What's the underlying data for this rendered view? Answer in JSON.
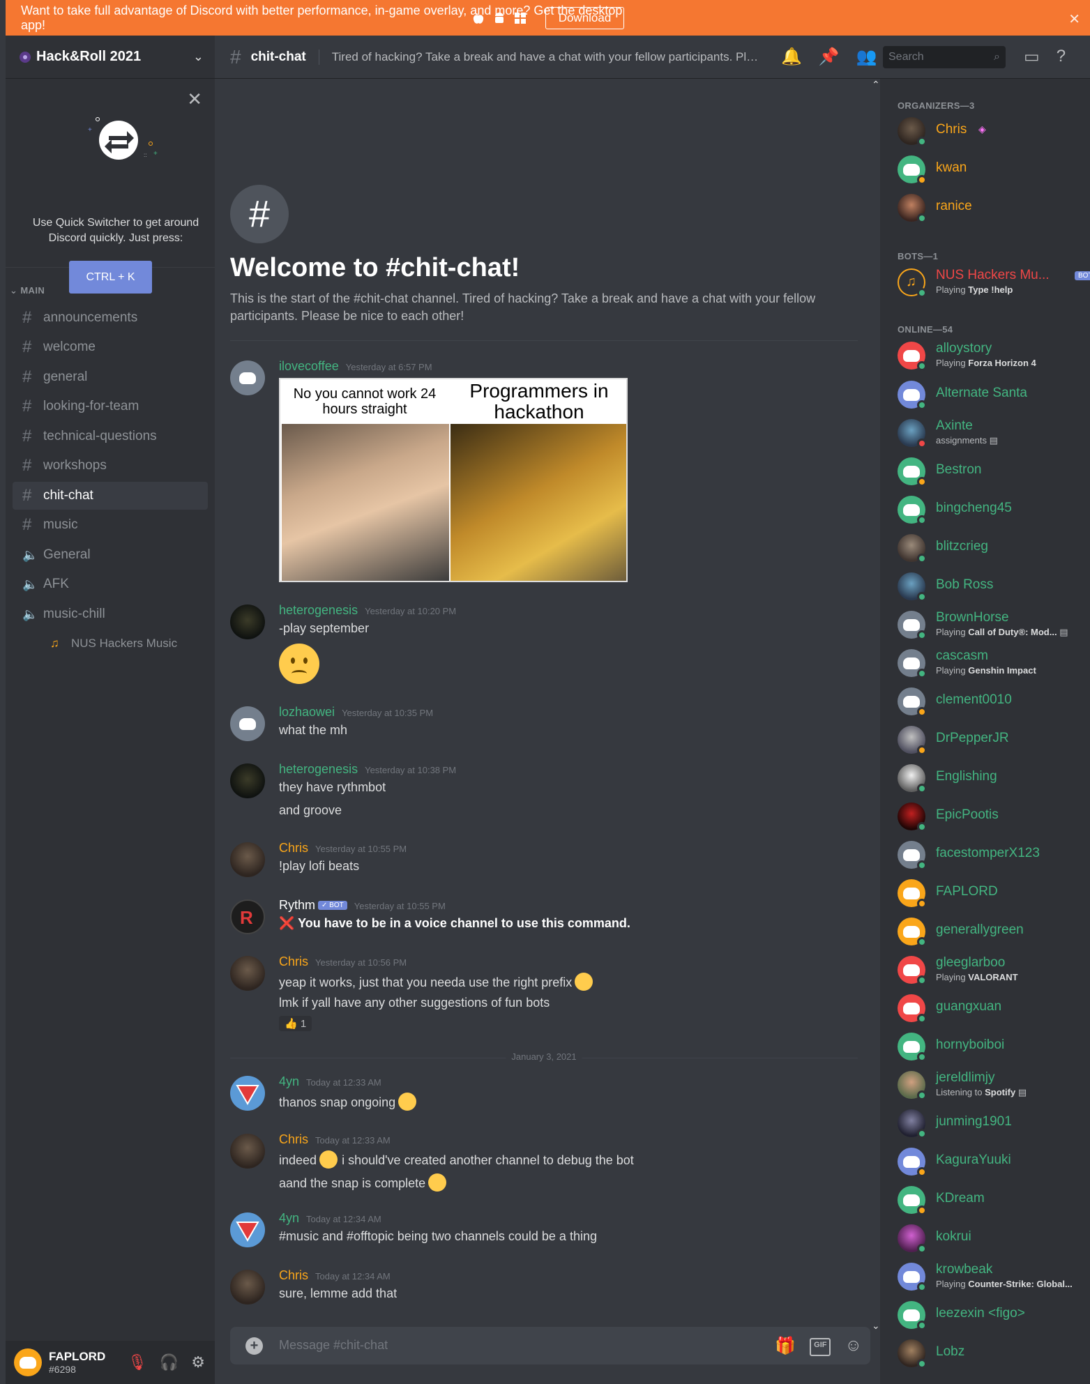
{
  "banner": {
    "message": "Want to take full advantage of Discord with better performance, in-game overlay, and more? Get the desktop app!",
    "download_label": "Download",
    "close_label": "✕"
  },
  "server": {
    "name": "Hack&Roll 2021"
  },
  "quick_switcher": {
    "text": "Use Quick Switcher to get around Discord quickly. Just press:",
    "shortcut": "CTRL + K"
  },
  "sidebar": {
    "category": "MAIN",
    "channels": [
      {
        "name": "announcements",
        "type": "text"
      },
      {
        "name": "welcome",
        "type": "text"
      },
      {
        "name": "general",
        "type": "text"
      },
      {
        "name": "looking-for-team",
        "type": "text"
      },
      {
        "name": "technical-questions",
        "type": "text"
      },
      {
        "name": "workshops",
        "type": "text"
      },
      {
        "name": "chit-chat",
        "type": "text",
        "active": true
      },
      {
        "name": "music",
        "type": "text"
      },
      {
        "name": "General",
        "type": "voice"
      },
      {
        "name": "AFK",
        "type": "voice"
      },
      {
        "name": "music-chill",
        "type": "voice"
      }
    ],
    "voice_member": "NUS Hackers Music"
  },
  "user": {
    "name": "FAPLORD",
    "tag": "#6298"
  },
  "channel": {
    "name": "chit-chat",
    "topic": "Tired of hacking? Take a break and have a chat with your fellow participants. Pleas...",
    "search_placeholder": "Search"
  },
  "welcome": {
    "title": "Welcome to #chit-chat!",
    "description": "This is the start of the #chit-chat channel. Tired of hacking? Take a break and have a chat with your fellow participants. Please be nice to each other!"
  },
  "messages": [
    {
      "author": "ilovecoffee",
      "timestamp": "Yesterday at 6:57 PM",
      "meme_left": "No you cannot work 24 hours straight",
      "meme_right": "Programmers in hackathon"
    },
    {
      "author": "heterogenesis",
      "timestamp": "Yesterday at 10:20 PM",
      "lines": [
        "-play september"
      ]
    },
    {
      "author": "lozhaowei",
      "timestamp": "Yesterday at 10:35 PM",
      "lines": [
        "what the mh"
      ]
    },
    {
      "author": "heterogenesis",
      "timestamp": "Yesterday at 10:38 PM",
      "lines": [
        "they have rythmbot",
        "and groove"
      ]
    },
    {
      "author": "Chris",
      "timestamp": "Yesterday at 10:55 PM",
      "lines": [
        "!play lofi beats"
      ]
    },
    {
      "author": "Rythm",
      "badge": "✓ BOT",
      "timestamp": "Yesterday at 10:55 PM",
      "lines": [
        "❌ You have to be in a voice channel to use this command."
      ]
    },
    {
      "author": "Chris",
      "timestamp": "Yesterday at 10:56 PM",
      "lines": [
        "yeap it works, just that you needa use the right prefix",
        "lmk if yall have any other suggestions of fun bots"
      ],
      "reaction": "👍 1"
    },
    {
      "author": "4yn",
      "timestamp": "Today at 12:33 AM",
      "lines": [
        "thanos snap ongoing"
      ]
    },
    {
      "author": "Chris",
      "timestamp": "Today at 12:33 AM",
      "lines": [
        "indeed",
        "i should've created another channel to debug the bot",
        "aand the snap is complete"
      ]
    },
    {
      "author": "4yn",
      "timestamp": "Today at 12:34 AM",
      "lines": [
        "#music and #offtopic being two channels could be a thing"
      ]
    },
    {
      "author": "Chris",
      "timestamp": "Today at 12:34 AM",
      "lines": [
        "sure, lemme add that"
      ]
    }
  ],
  "date_divider": "January 3, 2021",
  "composer": {
    "placeholder": "Message #chit-chat",
    "gif_label": "GIF"
  },
  "members": {
    "organizers_header": "ORGANIZERS—3",
    "bots_header": "BOTS—1",
    "online_header": "ONLINE—54",
    "bot_badge": "BOT",
    "organizers": [
      {
        "name": "Chris"
      },
      {
        "name": "kwan"
      },
      {
        "name": "ranice"
      }
    ],
    "bots": [
      {
        "name": "NUS Hackers Mu...",
        "activity_prefix": "Playing",
        "activity": "Type !help"
      }
    ],
    "online": [
      {
        "name": "alloystory",
        "activity_prefix": "Playing",
        "activity": "Forza Horizon 4"
      },
      {
        "name": "Alternate Santa"
      },
      {
        "name": "Axinte",
        "activity_prefix": "",
        "activity": "assignments"
      },
      {
        "name": "Bestron"
      },
      {
        "name": "bingcheng45"
      },
      {
        "name": "blitzcrieg"
      },
      {
        "name": "Bob Ross"
      },
      {
        "name": "BrownHorse",
        "activity_prefix": "Playing",
        "activity": "Call of Duty®: Mod..."
      },
      {
        "name": "cascasm",
        "activity_prefix": "Playing",
        "activity": "Genshin Impact"
      },
      {
        "name": "clement0010"
      },
      {
        "name": "DrPepperJR"
      },
      {
        "name": "Englishing"
      },
      {
        "name": "EpicPootis"
      },
      {
        "name": "facestomperX123"
      },
      {
        "name": "FAPLORD"
      },
      {
        "name": "generallygreen"
      },
      {
        "name": "gleeglarboo",
        "activity_prefix": "Playing",
        "activity": "VALORANT"
      },
      {
        "name": "guangxuan"
      },
      {
        "name": "hornyboiboi"
      },
      {
        "name": "jereldlimjy",
        "activity_prefix": "Listening to",
        "activity": "Spotify"
      },
      {
        "name": "junming1901"
      },
      {
        "name": "KaguraYuuki"
      },
      {
        "name": "KDream"
      },
      {
        "name": "kokrui"
      },
      {
        "name": "krowbeak",
        "activity_prefix": "Playing",
        "activity": "Counter-Strike: Global..."
      },
      {
        "name": "leezexin <figo>"
      },
      {
        "name": "Lobz"
      }
    ]
  },
  "colors": {
    "banner": "#f57731",
    "blurple": "#7289da",
    "online": "#43b581",
    "idle": "#faa61a",
    "dnd": "#f04747",
    "organizer": "#faa61a",
    "bot_name": "#f04747"
  }
}
